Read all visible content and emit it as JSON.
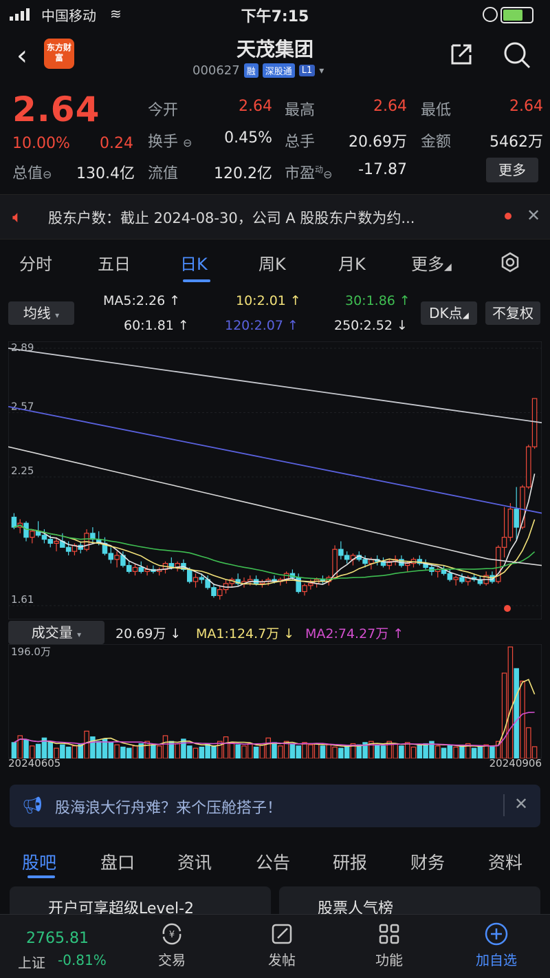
{
  "status_bar": {
    "carrier": "中国移动",
    "time": "下午7:15"
  },
  "header": {
    "logo_text": "东方财富",
    "title": "天茂集团",
    "code": "000627",
    "tags": [
      "融",
      "深股通",
      "L1"
    ]
  },
  "quote": {
    "price": "2.64",
    "change_pct": "10.00%",
    "change": "0.24",
    "rows": [
      [
        {
          "label": "今开",
          "value": "2.64",
          "color": "red"
        },
        {
          "label": "最高",
          "value": "2.64",
          "color": "red"
        },
        {
          "label": "最低",
          "value": "2.64",
          "color": "red"
        }
      ],
      [
        {
          "label": "换手",
          "value": "0.45%",
          "color": "white"
        },
        {
          "label": "总手",
          "value": "20.69万",
          "color": "white"
        },
        {
          "label": "金额",
          "value": "5462万",
          "color": "white"
        }
      ]
    ],
    "row3": [
      {
        "label": "总值",
        "value": "130.4亿"
      },
      {
        "label": "流值",
        "value": "120.2亿"
      },
      {
        "label": "市盈",
        "sup": "动",
        "value": "-17.87"
      }
    ],
    "more_label": "更多"
  },
  "news": {
    "text": "股东户数：截止 2024-08-30，公司 A 股股东户数为约..."
  },
  "kline_tabs": {
    "items": [
      "分时",
      "五日",
      "日K",
      "周K",
      "月K",
      "更多"
    ],
    "active": "日K"
  },
  "ma_legend": {
    "selector": "均线",
    "items": [
      {
        "text": "MA5:2.26 ↑",
        "color": "#e6e6e6"
      },
      {
        "text": "10:2.01 ↑",
        "color": "#f3e27a"
      },
      {
        "text": "30:1.86 ↑",
        "color": "#3fbf52"
      },
      {
        "text": "60:1.81 ↑",
        "color": "#e6e6e6"
      },
      {
        "text": "120:2.07 ↑",
        "color": "#5a62e0"
      },
      {
        "text": "250:2.52 ↓",
        "color": "#e6e6e6"
      }
    ],
    "dk_label": "DK点",
    "adjust_label": "不复权"
  },
  "chart_data": [
    {
      "type": "candlestick",
      "title": "",
      "ylim": [
        1.61,
        2.89
      ],
      "y_ticks": [
        "2.89",
        "2.57",
        "2.25",
        "1.61"
      ],
      "x_range": [
        "20240605",
        "20240906"
      ],
      "up_color": "#f24a3b",
      "down_color": "#4fd6e6",
      "candles": [
        [
          2.05,
          2.07,
          1.99,
          2.0
        ],
        [
          2.0,
          2.04,
          1.97,
          2.02
        ],
        [
          2.02,
          2.03,
          1.93,
          1.95
        ],
        [
          1.95,
          1.99,
          1.92,
          1.98
        ],
        [
          1.98,
          2.03,
          1.95,
          1.96
        ],
        [
          1.96,
          1.99,
          1.92,
          1.94
        ],
        [
          1.94,
          1.96,
          1.9,
          1.92
        ],
        [
          1.92,
          1.95,
          1.88,
          1.93
        ],
        [
          1.93,
          1.97,
          1.9,
          1.9
        ],
        [
          1.9,
          1.93,
          1.86,
          1.88
        ],
        [
          1.88,
          1.92,
          1.86,
          1.91
        ],
        [
          1.91,
          1.93,
          1.87,
          1.89
        ],
        [
          1.89,
          1.99,
          1.88,
          1.97
        ],
        [
          1.97,
          2.0,
          1.92,
          1.94
        ],
        [
          1.94,
          1.98,
          1.91,
          1.92
        ],
        [
          1.92,
          1.95,
          1.86,
          1.87
        ],
        [
          1.87,
          1.9,
          1.82,
          1.84
        ],
        [
          1.84,
          1.88,
          1.8,
          1.86
        ],
        [
          1.86,
          1.88,
          1.8,
          1.81
        ],
        [
          1.81,
          1.83,
          1.77,
          1.78
        ],
        [
          1.78,
          1.82,
          1.76,
          1.8
        ],
        [
          1.8,
          1.83,
          1.77,
          1.78
        ],
        [
          1.78,
          1.81,
          1.76,
          1.79
        ],
        [
          1.79,
          1.81,
          1.77,
          1.78
        ],
        [
          1.78,
          1.8,
          1.76,
          1.79
        ],
        [
          1.79,
          1.83,
          1.77,
          1.82
        ],
        [
          1.82,
          1.85,
          1.79,
          1.8
        ],
        [
          1.8,
          1.83,
          1.78,
          1.82
        ],
        [
          1.82,
          1.84,
          1.78,
          1.79
        ],
        [
          1.79,
          1.8,
          1.72,
          1.73
        ],
        [
          1.73,
          1.77,
          1.7,
          1.75
        ],
        [
          1.75,
          1.77,
          1.72,
          1.74
        ],
        [
          1.74,
          1.76,
          1.69,
          1.7
        ],
        [
          1.7,
          1.72,
          1.65,
          1.66
        ],
        [
          1.66,
          1.71,
          1.64,
          1.69
        ],
        [
          1.69,
          1.74,
          1.67,
          1.72
        ],
        [
          1.72,
          1.75,
          1.7,
          1.74
        ],
        [
          1.74,
          1.77,
          1.71,
          1.72
        ],
        [
          1.72,
          1.75,
          1.7,
          1.73
        ],
        [
          1.73,
          1.76,
          1.71,
          1.74
        ],
        [
          1.74,
          1.76,
          1.71,
          1.72
        ],
        [
          1.72,
          1.74,
          1.7,
          1.73
        ],
        [
          1.73,
          1.75,
          1.71,
          1.74
        ],
        [
          1.74,
          1.76,
          1.72,
          1.73
        ],
        [
          1.73,
          1.75,
          1.71,
          1.74
        ],
        [
          1.74,
          1.78,
          1.72,
          1.77
        ],
        [
          1.77,
          1.79,
          1.74,
          1.75
        ],
        [
          1.75,
          1.77,
          1.67,
          1.68
        ],
        [
          1.68,
          1.72,
          1.66,
          1.71
        ],
        [
          1.71,
          1.74,
          1.69,
          1.72
        ],
        [
          1.72,
          1.75,
          1.7,
          1.74
        ],
        [
          1.74,
          1.76,
          1.72,
          1.73
        ],
        [
          1.73,
          1.76,
          1.71,
          1.75
        ],
        [
          1.75,
          1.91,
          1.74,
          1.89
        ],
        [
          1.89,
          1.93,
          1.84,
          1.86
        ],
        [
          1.86,
          1.88,
          1.82,
          1.84
        ],
        [
          1.84,
          1.87,
          1.81,
          1.86
        ],
        [
          1.86,
          1.88,
          1.83,
          1.84
        ],
        [
          1.84,
          1.86,
          1.8,
          1.82
        ],
        [
          1.82,
          1.85,
          1.79,
          1.84
        ],
        [
          1.84,
          1.86,
          1.81,
          1.83
        ],
        [
          1.83,
          1.85,
          1.8,
          1.81
        ],
        [
          1.81,
          1.84,
          1.79,
          1.83
        ],
        [
          1.83,
          1.86,
          1.81,
          1.84
        ],
        [
          1.84,
          1.86,
          1.8,
          1.81
        ],
        [
          1.81,
          1.83,
          1.78,
          1.82
        ],
        [
          1.82,
          1.85,
          1.8,
          1.84
        ],
        [
          1.84,
          1.86,
          1.81,
          1.82
        ],
        [
          1.82,
          1.84,
          1.79,
          1.8
        ],
        [
          1.8,
          1.82,
          1.76,
          1.78
        ],
        [
          1.78,
          1.8,
          1.75,
          1.79
        ],
        [
          1.79,
          1.81,
          1.76,
          1.77
        ],
        [
          1.77,
          1.79,
          1.73,
          1.74
        ],
        [
          1.74,
          1.76,
          1.71,
          1.75
        ],
        [
          1.75,
          1.77,
          1.72,
          1.73
        ],
        [
          1.73,
          1.76,
          1.71,
          1.75
        ],
        [
          1.75,
          1.77,
          1.73,
          1.74
        ],
        [
          1.74,
          1.76,
          1.71,
          1.72
        ],
        [
          1.72,
          1.78,
          1.71,
          1.76
        ],
        [
          1.76,
          1.78,
          1.72,
          1.73
        ],
        [
          1.73,
          1.91,
          1.72,
          1.9
        ],
        [
          1.9,
          2.1,
          1.85,
          1.95
        ],
        [
          1.95,
          2.12,
          1.93,
          2.09
        ],
        [
          2.09,
          2.2,
          1.94,
          2.0
        ],
        [
          2.0,
          2.21,
          1.99,
          2.2
        ],
        [
          2.2,
          2.41,
          2.19,
          2.4
        ],
        [
          2.4,
          2.64,
          2.39,
          2.64
        ]
      ]
    },
    {
      "type": "bar",
      "title": "",
      "ylim": [
        0,
        196.0
      ],
      "y_label": "196.0万",
      "x_range": [
        "20240605",
        "20240906"
      ],
      "legend": [
        {
          "name": "成交量",
          "text": "20.69万 ↓",
          "color": "#e6e6e6"
        },
        {
          "name": "MA1",
          "text": "MA1:124.7万 ↓",
          "color": "#f3e27a"
        },
        {
          "name": "MA2",
          "text": "MA2:74.27万 ↑",
          "color": "#d44fd0"
        }
      ],
      "values": [
        28,
        40,
        33,
        22,
        25,
        36,
        30,
        18,
        24,
        20,
        22,
        26,
        48,
        38,
        30,
        34,
        28,
        24,
        20,
        18,
        22,
        26,
        30,
        24,
        22,
        40,
        30,
        26,
        34,
        22,
        18,
        20,
        26,
        22,
        30,
        38,
        28,
        24,
        22,
        26,
        20,
        24,
        36,
        28,
        22,
        30,
        26,
        22,
        28,
        24,
        26,
        22,
        24,
        20,
        18,
        22,
        26,
        24,
        28,
        30,
        24,
        22,
        30,
        26,
        22,
        28,
        20,
        24,
        26,
        30,
        22,
        18,
        24,
        20,
        22,
        26,
        18,
        20,
        24,
        22,
        30,
        150,
        196,
        158,
        136,
        54,
        20.69
      ]
    }
  ],
  "promo": {
    "text": "股海浪大行舟难？来个压舱搭子！"
  },
  "bottom_tabs": {
    "items": [
      "股吧",
      "盘口",
      "资讯",
      "公告",
      "研报",
      "财务",
      "资料"
    ],
    "active": "股吧"
  },
  "cards": [
    {
      "text": "开户可享超级Level-2"
    },
    {
      "text": "股票人气榜"
    }
  ],
  "bottom_nav": {
    "index_value": "2765.81",
    "index_name": "上证",
    "index_change": "-0.81%",
    "items": [
      "交易",
      "发帖",
      "功能",
      "加自选"
    ]
  },
  "colors": {
    "up": "#f24a3b",
    "down": "#4fd6e6",
    "accent": "#4c8dff"
  }
}
